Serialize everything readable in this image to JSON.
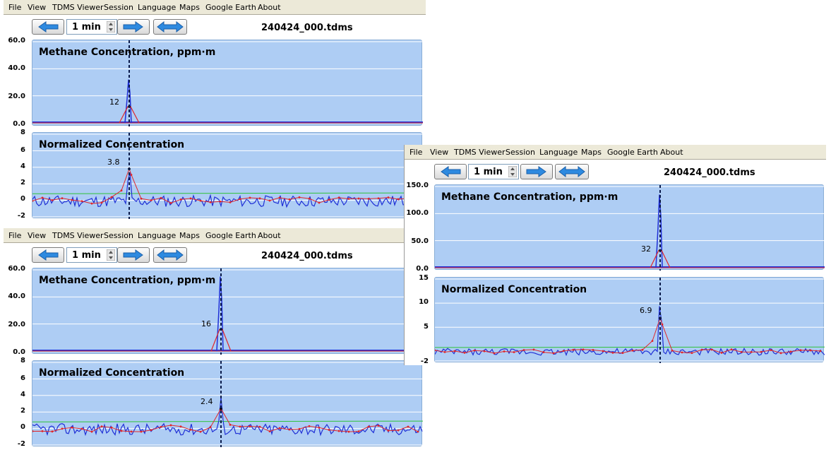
{
  "windows": [
    {
      "menu": [
        "File",
        "View",
        "TDMS Viewer",
        "Session",
        "Language",
        "Maps",
        "Google Earth",
        "About"
      ],
      "interval": "1 min",
      "filename": "240424_000.tdms",
      "top_panel": {
        "title": "Methane Concentration, ppm·m",
        "yticks": [
          "60.0",
          "40.0",
          "20.0",
          "0.0"
        ],
        "ylim": [
          0,
          60
        ],
        "peak_label": "12",
        "peak_value": 12,
        "spike_max": 32
      },
      "bottom_panel": {
        "title": "Normalized Concentration",
        "yticks": [
          "8",
          "6",
          "4",
          "2",
          "0",
          "-2"
        ],
        "ylim": [
          -2,
          8
        ],
        "peak_label": "3.8",
        "peak_value": 3.8,
        "spike_max": 4.5
      }
    },
    {
      "menu": [
        "File",
        "View",
        "TDMS Viewer",
        "Session",
        "Language",
        "Maps",
        "Google Earth",
        "About"
      ],
      "interval": "1 min",
      "filename": "240424_000.tdms",
      "top_panel": {
        "title": "Methane Concentration, ppm·m",
        "yticks": [
          "60.0",
          "40.0",
          "20.0",
          "0.0"
        ],
        "ylim": [
          0,
          60
        ],
        "peak_label": "16",
        "peak_value": 16,
        "spike_max": 55
      },
      "bottom_panel": {
        "title": "Normalized Concentration",
        "yticks": [
          "8",
          "6",
          "4",
          "2",
          "0",
          "-2"
        ],
        "ylim": [
          -2,
          8
        ],
        "peak_label": "2.4",
        "peak_value": 2.4,
        "spike_max": 3.8
      }
    },
    {
      "menu": [
        "File",
        "View",
        "TDMS Viewer",
        "Session",
        "Language",
        "Maps",
        "Google Earth",
        "About"
      ],
      "interval": "1 min",
      "filename": "240424_000.tdms",
      "top_panel": {
        "title": "Methane Concentration, ppm·m",
        "yticks": [
          "150.0",
          "100.0",
          "50.0",
          "0.0"
        ],
        "ylim": [
          0,
          150
        ],
        "peak_label": "32",
        "peak_value": 32,
        "spike_max": 135
      },
      "bottom_panel": {
        "title": "Normalized Concentration",
        "yticks": [
          "15",
          "10",
          "5",
          "-2"
        ],
        "ylim": [
          -2,
          15
        ],
        "peak_label": "6.9",
        "peak_value": 6.9,
        "spike_max": 12.5
      }
    }
  ],
  "colors": {
    "panel_bg": "#aecdf4",
    "raw_series": "#1f2fd6",
    "smoothed_series": "#e0262a",
    "baseline_series": "#2fc23a",
    "cursor": "#0a1a4a"
  },
  "icons": [
    "arrow-left-icon",
    "arrow-right-icon",
    "arrow-both-icon",
    "spin-updown-icon"
  ]
}
